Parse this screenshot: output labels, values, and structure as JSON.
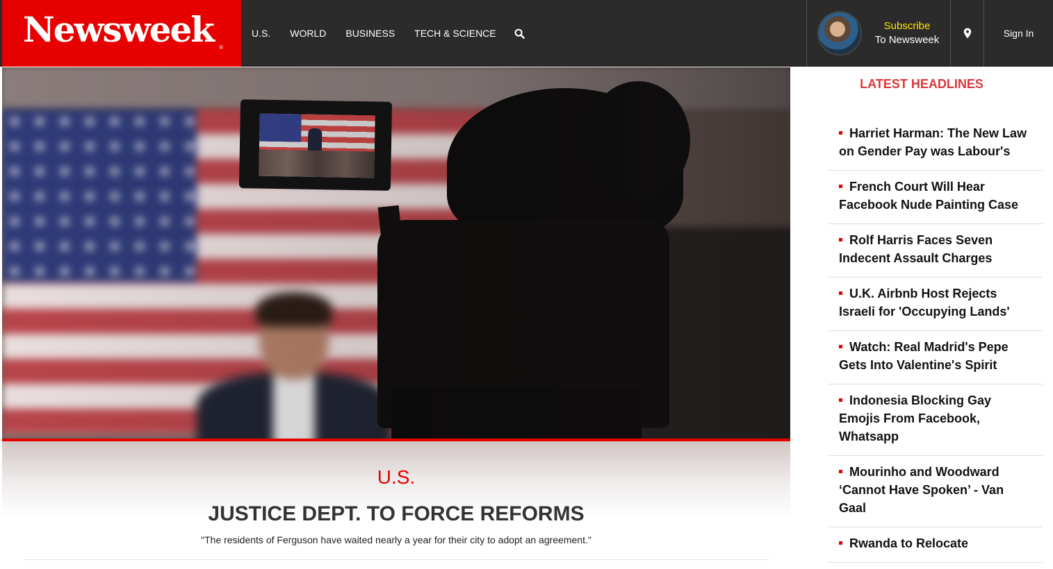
{
  "brand": {
    "logo": "Newsweek",
    "logo_mark": "®",
    "accent_color": "#e60000"
  },
  "nav": {
    "items": [
      {
        "label": "U.S."
      },
      {
        "label": "WORLD"
      },
      {
        "label": "BUSINESS"
      },
      {
        "label": "TECH & SCIENCE"
      }
    ],
    "search_icon": "search-icon"
  },
  "account": {
    "subscribe_line1": "Subscribe",
    "subscribe_line2": "To Newsweek",
    "location_icon": "map-pin-icon",
    "sign_in": "Sign In"
  },
  "hero": {
    "section": "U.S.",
    "headline": "JUSTICE DEPT. TO FORCE REFORMS",
    "dek": "\"The residents of Ferguson have waited nearly a year for their city to adopt an agreement.\""
  },
  "sidebar": {
    "title": "LATEST HEADLINES",
    "headlines": [
      {
        "title": "Harriet Harman: The New Law on Gender Pay was Labour's"
      },
      {
        "title": "French Court Will Hear Facebook Nude Painting Case"
      },
      {
        "title": "Rolf Harris Faces Seven Indecent Assault Charges"
      },
      {
        "title": "U.K. Airbnb Host Rejects Israeli for 'Occupying Lands'"
      },
      {
        "title": "Watch: Real Madrid's Pepe Gets Into Valentine's Spirit"
      },
      {
        "title": "Indonesia Blocking Gay Emojis From Facebook, Whatsapp"
      },
      {
        "title": "Mourinho and Woodward ‘Cannot Have Spoken’ - Van Gaal"
      },
      {
        "title": "Rwanda to Relocate"
      }
    ]
  }
}
